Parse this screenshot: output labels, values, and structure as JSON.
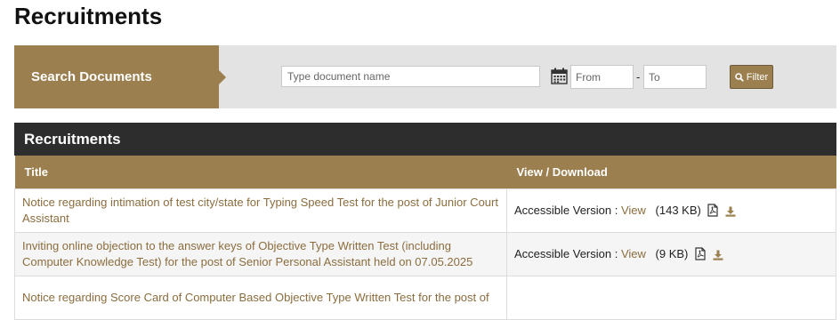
{
  "page": {
    "title": "Recruitments"
  },
  "search": {
    "label": "Search Documents",
    "doc_placeholder": "Type document name",
    "from_placeholder": "From",
    "to_placeholder": "To",
    "separator": "-",
    "filter_label": "Filter",
    "icons": {
      "calendar": "calendar-icon",
      "filter": "search-icon"
    }
  },
  "section": {
    "title": "Recruitments"
  },
  "table": {
    "headers": [
      "Title",
      "View / Download"
    ],
    "rows": [
      {
        "title": "Notice regarding intimation of test city/state for Typing Speed Test for the post of Junior Court Assistant",
        "version_label": "Accessible Version :",
        "view": "View",
        "size": "(143 KB)"
      },
      {
        "title": "Inviting online objection to the answer keys of Objective Type Written Test (including Computer Knowledge Test) for the post of Senior Personal Assistant held on 07.05.2025",
        "version_label": "Accessible Version :",
        "view": "View",
        "size": "(9 KB)"
      },
      {
        "title": "Notice regarding Score Card of Computer Based Objective Type Written Test for the post of",
        "version_label": "",
        "view": "",
        "size": ""
      }
    ]
  },
  "colors": {
    "accent": "#9b7f4e",
    "link": "#8b6d3e",
    "header_dark": "#2d2d2d"
  }
}
